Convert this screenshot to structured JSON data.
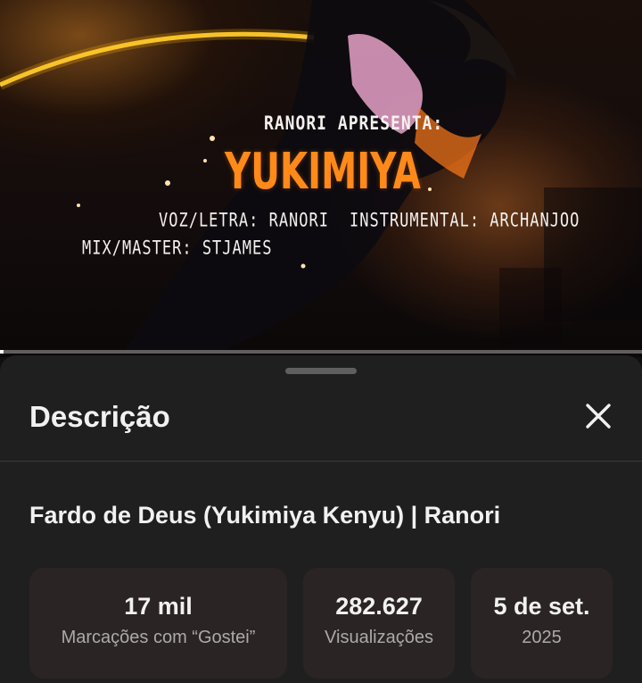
{
  "video": {
    "overlay": {
      "presents": "RANORI APRESENTA:",
      "title": "YUKIMIYA",
      "voz_letra": "VOZ/LETRA: RANORI",
      "instrumental": "INSTRUMENTAL: ARCHANJOO",
      "mix_master": "MIX/MASTER: STJAMES"
    },
    "progress": 0.005
  },
  "sheet": {
    "title": "Descrição",
    "close_icon": "close-icon",
    "video_title": "Fardo de Deus (Yukimiya Kenyu) | Ranori",
    "stats": {
      "likes": {
        "value": "17 mil",
        "label": "Marcações com “Gostei”"
      },
      "views": {
        "value": "282.627",
        "label": "Visualizações"
      },
      "date": {
        "value": "5 de set.",
        "label": "2025"
      }
    }
  },
  "colors": {
    "accent_orange": "#ff8a1a",
    "sheet_bg": "#1f1f1f",
    "stat_bg": "#2b2424"
  }
}
